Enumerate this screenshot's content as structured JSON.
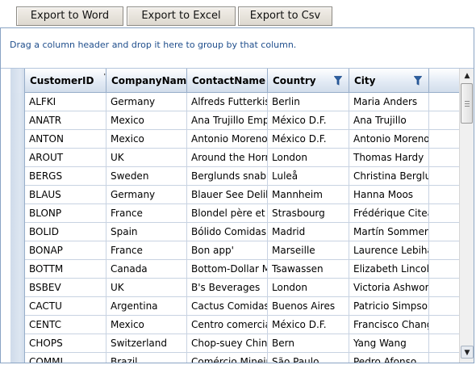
{
  "toolbar": {
    "export_word": "Export to Word",
    "export_excel": "Export to Excel",
    "export_csv": "Export to Csv"
  },
  "group_panel": {
    "hint": "Drag a column header and drop it here to group by that column."
  },
  "grid": {
    "columns": [
      {
        "label": "CustomerID",
        "filter": false
      },
      {
        "label": "CompanyName",
        "filter": false
      },
      {
        "label": "ContactName",
        "filter": false
      },
      {
        "label": "Country",
        "filter": true
      },
      {
        "label": "City",
        "filter": true
      }
    ],
    "rows": [
      [
        "ALFKI",
        "Germany",
        "Alfreds Futterkiste",
        "Berlin",
        "Maria Anders"
      ],
      [
        "ANATR",
        "Mexico",
        "Ana Trujillo Emparedados y helados",
        "México D.F.",
        "Ana Trujillo"
      ],
      [
        "ANTON",
        "Mexico",
        "Antonio Moreno Taquería",
        "México D.F.",
        "Antonio Moreno"
      ],
      [
        "AROUT",
        "UK",
        "Around the Horn",
        "London",
        "Thomas Hardy"
      ],
      [
        "BERGS",
        "Sweden",
        "Berglunds snabbköp",
        "Luleå",
        "Christina Berglund"
      ],
      [
        "BLAUS",
        "Germany",
        "Blauer See Delikatessen",
        "Mannheim",
        "Hanna Moos"
      ],
      [
        "BLONP",
        "France",
        "Blondel père et fils",
        "Strasbourg",
        "Frédérique Citeaux"
      ],
      [
        "BOLID",
        "Spain",
        "Bólido Comidas preparadas",
        "Madrid",
        "Martín Sommer"
      ],
      [
        "BONAP",
        "France",
        "Bon app'",
        "Marseille",
        "Laurence Lebihan"
      ],
      [
        "BOTTM",
        "Canada",
        "Bottom-Dollar Markets",
        "Tsawassen",
        "Elizabeth Lincoln"
      ],
      [
        "BSBEV",
        "UK",
        "B's Beverages",
        "London",
        "Victoria Ashworth"
      ],
      [
        "CACTU",
        "Argentina",
        "Cactus Comidas para llevar",
        "Buenos Aires",
        "Patricio Simpson"
      ],
      [
        "CENTC",
        "Mexico",
        "Centro comercial Moctezuma",
        "México D.F.",
        "Francisco Chang"
      ],
      [
        "CHOPS",
        "Switzerland",
        "Chop-suey Chinese",
        "Bern",
        "Yang Wang"
      ],
      [
        "COMMI",
        "Brazil",
        "Comércio Mineiro",
        "São Paulo",
        "Pedro Afonso"
      ]
    ]
  },
  "icons": {
    "filter": "filter-funnel-icon",
    "scroll_up": "arrow-up-icon",
    "scroll_down": "arrow-down-icon"
  },
  "colors": {
    "header_gradient_bottom": "#d2ddeb",
    "grid_border": "#8aa4c4",
    "group_text": "#1f4e8c",
    "filter_icon": "#1f4e8c"
  }
}
